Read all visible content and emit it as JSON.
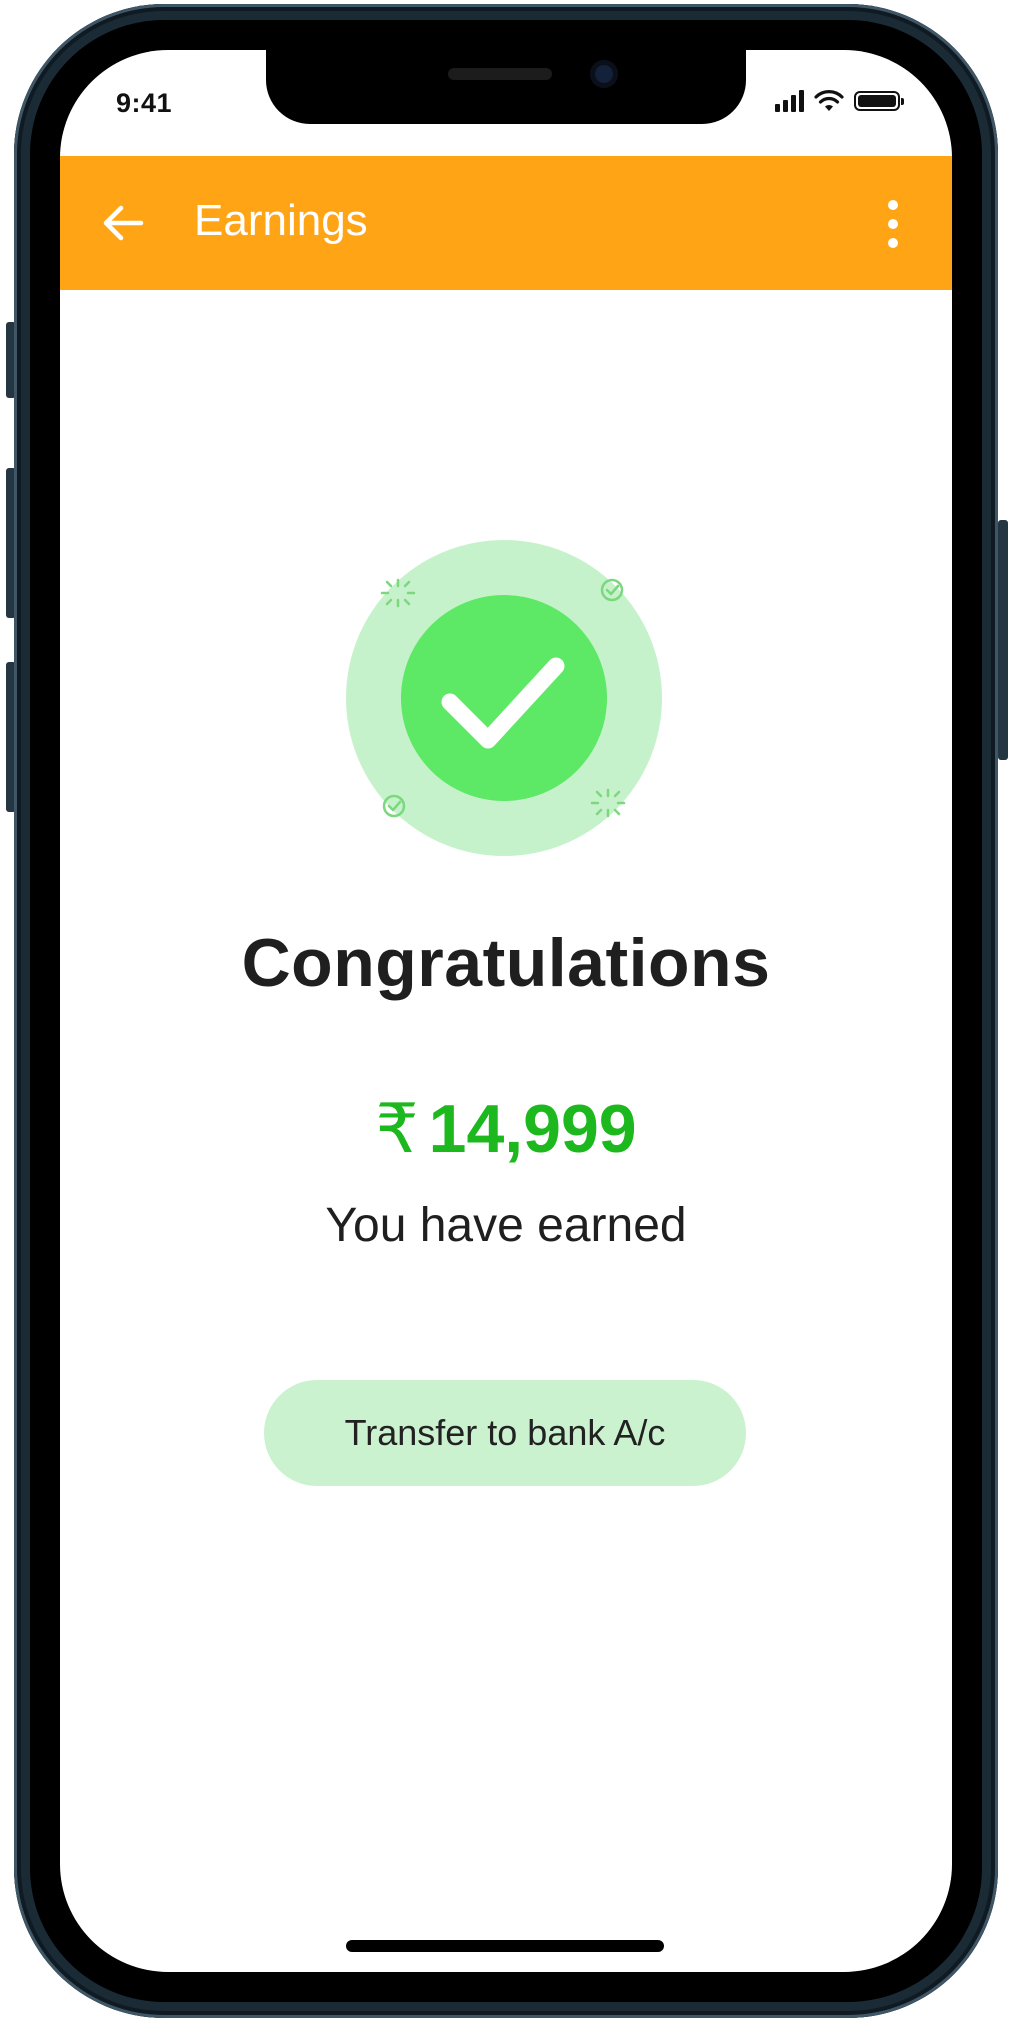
{
  "status_bar": {
    "time": "9:41"
  },
  "app_bar": {
    "title": "Earnings",
    "back_icon": "arrow-left-icon",
    "menu_icon": "more-vertical-icon",
    "background_color": "#ffa414"
  },
  "success": {
    "icon": "check-circle-icon",
    "headline": "Congratulations",
    "currency_symbol": "₹",
    "amount": "14,999",
    "amount_color": "#1db81d",
    "subtext": "You have earned"
  },
  "actions": {
    "transfer_label": "Transfer to bank A/c",
    "transfer_bg": "#cbf2cf"
  }
}
